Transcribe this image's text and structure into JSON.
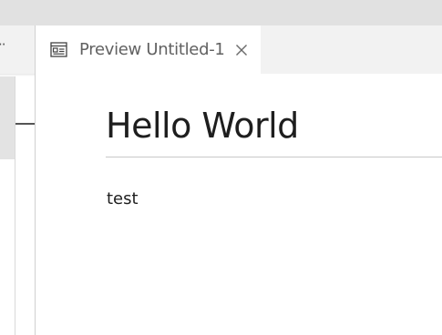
{
  "left_group": {
    "more_icon": "more-icon"
  },
  "editor": {
    "tab": {
      "icon": "preview-icon",
      "label": "Preview Untitled-1",
      "close_icon": "close-icon"
    }
  },
  "preview": {
    "heading": "Hello World",
    "paragraph": "test"
  },
  "colors": {
    "title_strip": "#e1e1e1",
    "tabbar": "#f2f2f2",
    "active_tab": "#ffffff",
    "text": "#1e1e1e",
    "tab_text": "#616161",
    "rule": "#c8c8c8"
  }
}
